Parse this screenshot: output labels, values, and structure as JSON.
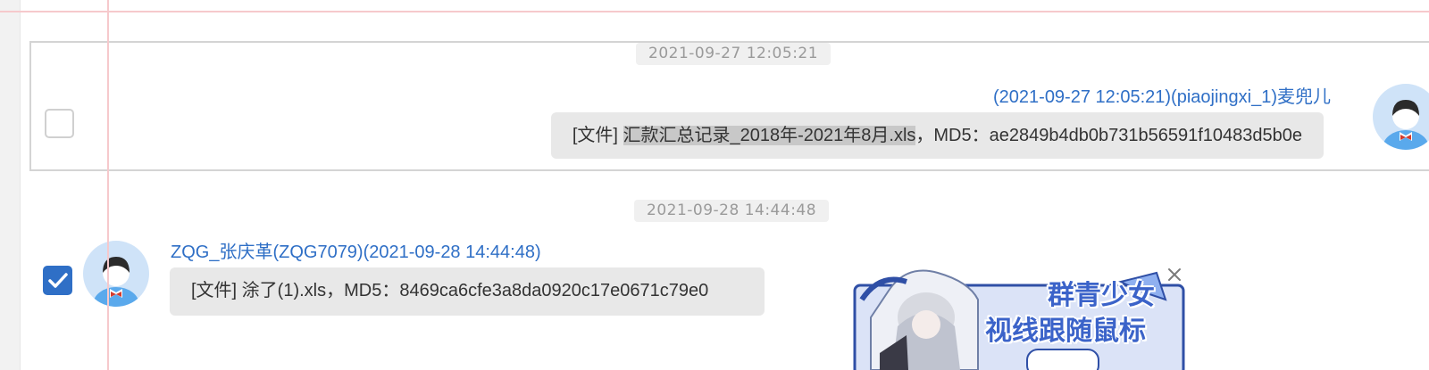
{
  "messages": [
    {
      "timestamp": "2021-09-27 12:05:21",
      "sender": "(2021-09-27 12:05:21)(piaojingxi_1)麦兜儿",
      "content_prefix": "[文件] ",
      "content_highlight": "汇款汇总记录_2018年-2021年8月.xls",
      "content_suffix": "，MD5：ae2849b4db0b731b56591f10483d5b0e",
      "checked": false,
      "side": "right"
    },
    {
      "timestamp": "2021-09-28 14:44:48",
      "sender": "ZQG_张庆革(ZQG7079)(2021-09-28 14:44:48)",
      "content": "[文件] 涂了(1).xls，MD5：8469ca6cfe3a8da0920c17e0671c79e0",
      "checked": true,
      "side": "left"
    }
  ],
  "ad": {
    "title_line1": "群青少女",
    "title_line2": "视线跟随鼠标",
    "close_icon": "close-icon"
  },
  "colors": {
    "accent": "#2f6fc6",
    "bubble": "#e8e8e8",
    "timestamp_bg": "#f0f0f0",
    "timestamp_text": "#9a9a9a"
  }
}
